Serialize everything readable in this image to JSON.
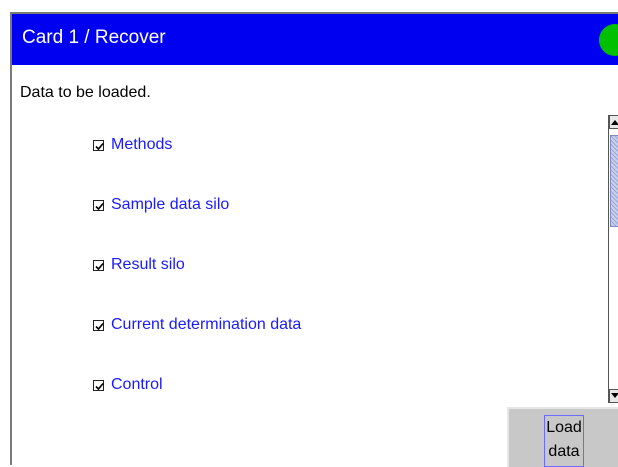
{
  "window": {
    "title": "Card 1 / Recover",
    "status_color": "#00c000"
  },
  "subtitle": "Data to be loaded.",
  "items": [
    {
      "label": "Methods",
      "checked": true
    },
    {
      "label": "Sample data silo",
      "checked": true
    },
    {
      "label": "Result silo",
      "checked": true
    },
    {
      "label": "Current determination data",
      "checked": true
    },
    {
      "label": "Control",
      "checked": true
    }
  ],
  "buttons": {
    "load_line1": "Load",
    "load_line2": "data"
  },
  "icons": {
    "checkbox": "check-icon",
    "scroll_up": "arrow-up-icon",
    "scroll_down": "arrow-down-icon"
  }
}
